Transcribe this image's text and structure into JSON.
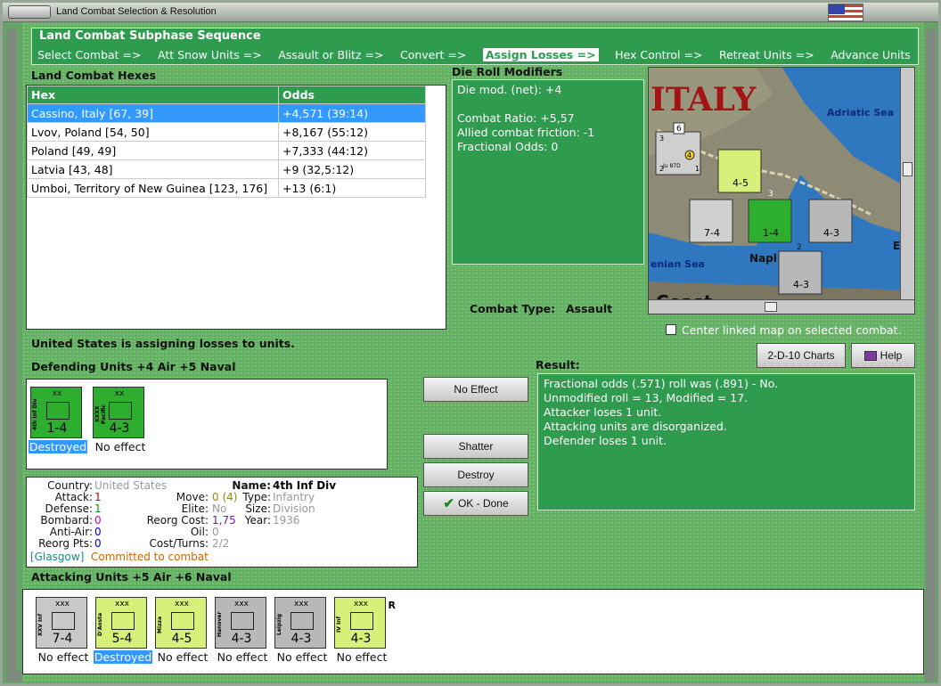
{
  "window": {
    "title": "Land Combat Selection & Resolution"
  },
  "subphase": {
    "heading": "Land Combat Subphase Sequence",
    "steps": [
      "Select Combat =>",
      "Att Snow Units =>",
      "Assault or Blitz =>",
      "Convert =>",
      "Assign Losses =>",
      "Hex Control =>",
      "Retreat Units =>",
      "Advance Units"
    ],
    "active_index": 4
  },
  "hexes": {
    "heading": "Land Combat Hexes",
    "columns": [
      "Hex",
      "Odds"
    ],
    "rows": [
      [
        "Cassino, Italy [67, 39]",
        "+4,571 (39:14)"
      ],
      [
        "Lvov, Poland [54, 50]",
        "+8,167 (55:12)"
      ],
      [
        "Poland [49, 49]",
        "+7,333 (44:12)"
      ],
      [
        "Latvia [43, 48]",
        "+9 (32,5:12)"
      ],
      [
        "Umboi, Territory of New Guinea [123, 176]",
        "+13 (6:1)"
      ]
    ],
    "selected": 0
  },
  "modifiers": {
    "heading": "Die Roll Modifiers",
    "lines": [
      "Die mod. (net): +4",
      "",
      "Combat Ratio: +5,57",
      "Allied combat friction: -1",
      "Fractional Odds: 0"
    ]
  },
  "combat_type": {
    "label": "Combat Type:",
    "value": "Assault"
  },
  "map": {
    "country_label": "ITALY",
    "sea1": "Adriatic Sea",
    "sea2": "enian Sea",
    "city": "Napl",
    "coast": "Coast",
    "attacker_stack": "6",
    "stack_vals": [
      "3",
      "2",
      "1"
    ],
    "unit_label": "Ju 87D",
    "counters": [
      "7-4",
      "4-5",
      "1-4",
      "4-3",
      "4-3"
    ],
    "badge1": "3",
    "badge2": "2",
    "circle": "4",
    "right_letter": "E"
  },
  "center_map": {
    "label": "Center linked map on selected combat."
  },
  "status": "United States is assigning losses to units.",
  "defending": {
    "heading": "Defending Units +4 Air +5 Naval",
    "units": [
      {
        "name": "4th Inf Div",
        "size": "xx",
        "value": "1-4",
        "color": "#2eae2e",
        "caption": "Destroyed",
        "selected": true
      },
      {
        "name": "XXXX Pacific",
        "size": "xx",
        "value": "4-3",
        "color": "#2eae2e",
        "caption": "No effect",
        "selected": false
      }
    ]
  },
  "buttons": {
    "no_effect": "No Effect",
    "shatter": "Shatter",
    "destroy": "Destroy",
    "ok_done": "OK - Done",
    "charts": "2-D-10 Charts",
    "help": "Help"
  },
  "result": {
    "heading": "Result:",
    "lines": [
      "Fractional odds (.571) roll was (.891)  - No.",
      "Unmodified roll = 13, Modified = 17.",
      "Attacker loses 1 unit.",
      "Attacking units are disorganized.",
      "Defender loses 1 unit."
    ]
  },
  "info": {
    "country_label": "Country:",
    "country": "United States",
    "name_label": "Name:",
    "name": "4th Inf Div",
    "attack_label": "Attack:",
    "attack": "1",
    "defense_label": "Defense:",
    "defense": "1",
    "bombard_label": "Bombard:",
    "bombard": "0",
    "antiair_label": "Anti-Air:",
    "antiair": "0",
    "reorg_pts_label": "Reorg Pts:",
    "reorg_pts": "0",
    "move_label": "Move:",
    "move": "0 (4)",
    "elite_label": "Elite:",
    "elite": "No",
    "reorg_cost_label": "Reorg Cost:",
    "reorg_cost": "1,75",
    "oil_label": "Oil:",
    "oil": "0",
    "cost_turns_label": "Cost/Turns:",
    "cost_turns": "2/2",
    "type_label": "Type:",
    "type": "Infantry",
    "size_label": "Size:",
    "size": "Division",
    "year_label": "Year:",
    "year": "1936",
    "location": "[Glasgow]",
    "committed": "Committed to combat"
  },
  "attacking": {
    "heading": "Attacking Units +5 Air +6 Naval",
    "units": [
      {
        "name": "XXV Inf",
        "size": "xxx",
        "value": "7-4",
        "color": "#c8c8c8",
        "caption": "No effect",
        "selected": false
      },
      {
        "name": "D'Aosta",
        "size": "xxx",
        "value": "5-4",
        "color": "#d6f07a",
        "caption": "Destroyed",
        "selected": true
      },
      {
        "name": "Mizza",
        "size": "xxx",
        "value": "4-5",
        "color": "#d6f07a",
        "caption": "No effect",
        "selected": false
      },
      {
        "name": "Hanover",
        "size": "xxx",
        "value": "4-3",
        "color": "#b8b8b8",
        "caption": "No effect",
        "selected": false
      },
      {
        "name": "Leipzig",
        "size": "xxx",
        "value": "4-3",
        "color": "#b8b8b8",
        "caption": "No effect",
        "selected": false
      },
      {
        "name": "IV Inf",
        "size": "xxx",
        "value": "4-3",
        "color": "#d6f07a",
        "caption": "No effect",
        "selected": false,
        "badge": "R"
      }
    ]
  },
  "colors": {
    "panel_green": "#2e9b4f",
    "selection_blue": "#3399ff",
    "attack_red": "#cc0000",
    "defense_green": "#009900",
    "bombard_magenta": "#cc00cc",
    "antiair_blue": "#0000cc"
  }
}
